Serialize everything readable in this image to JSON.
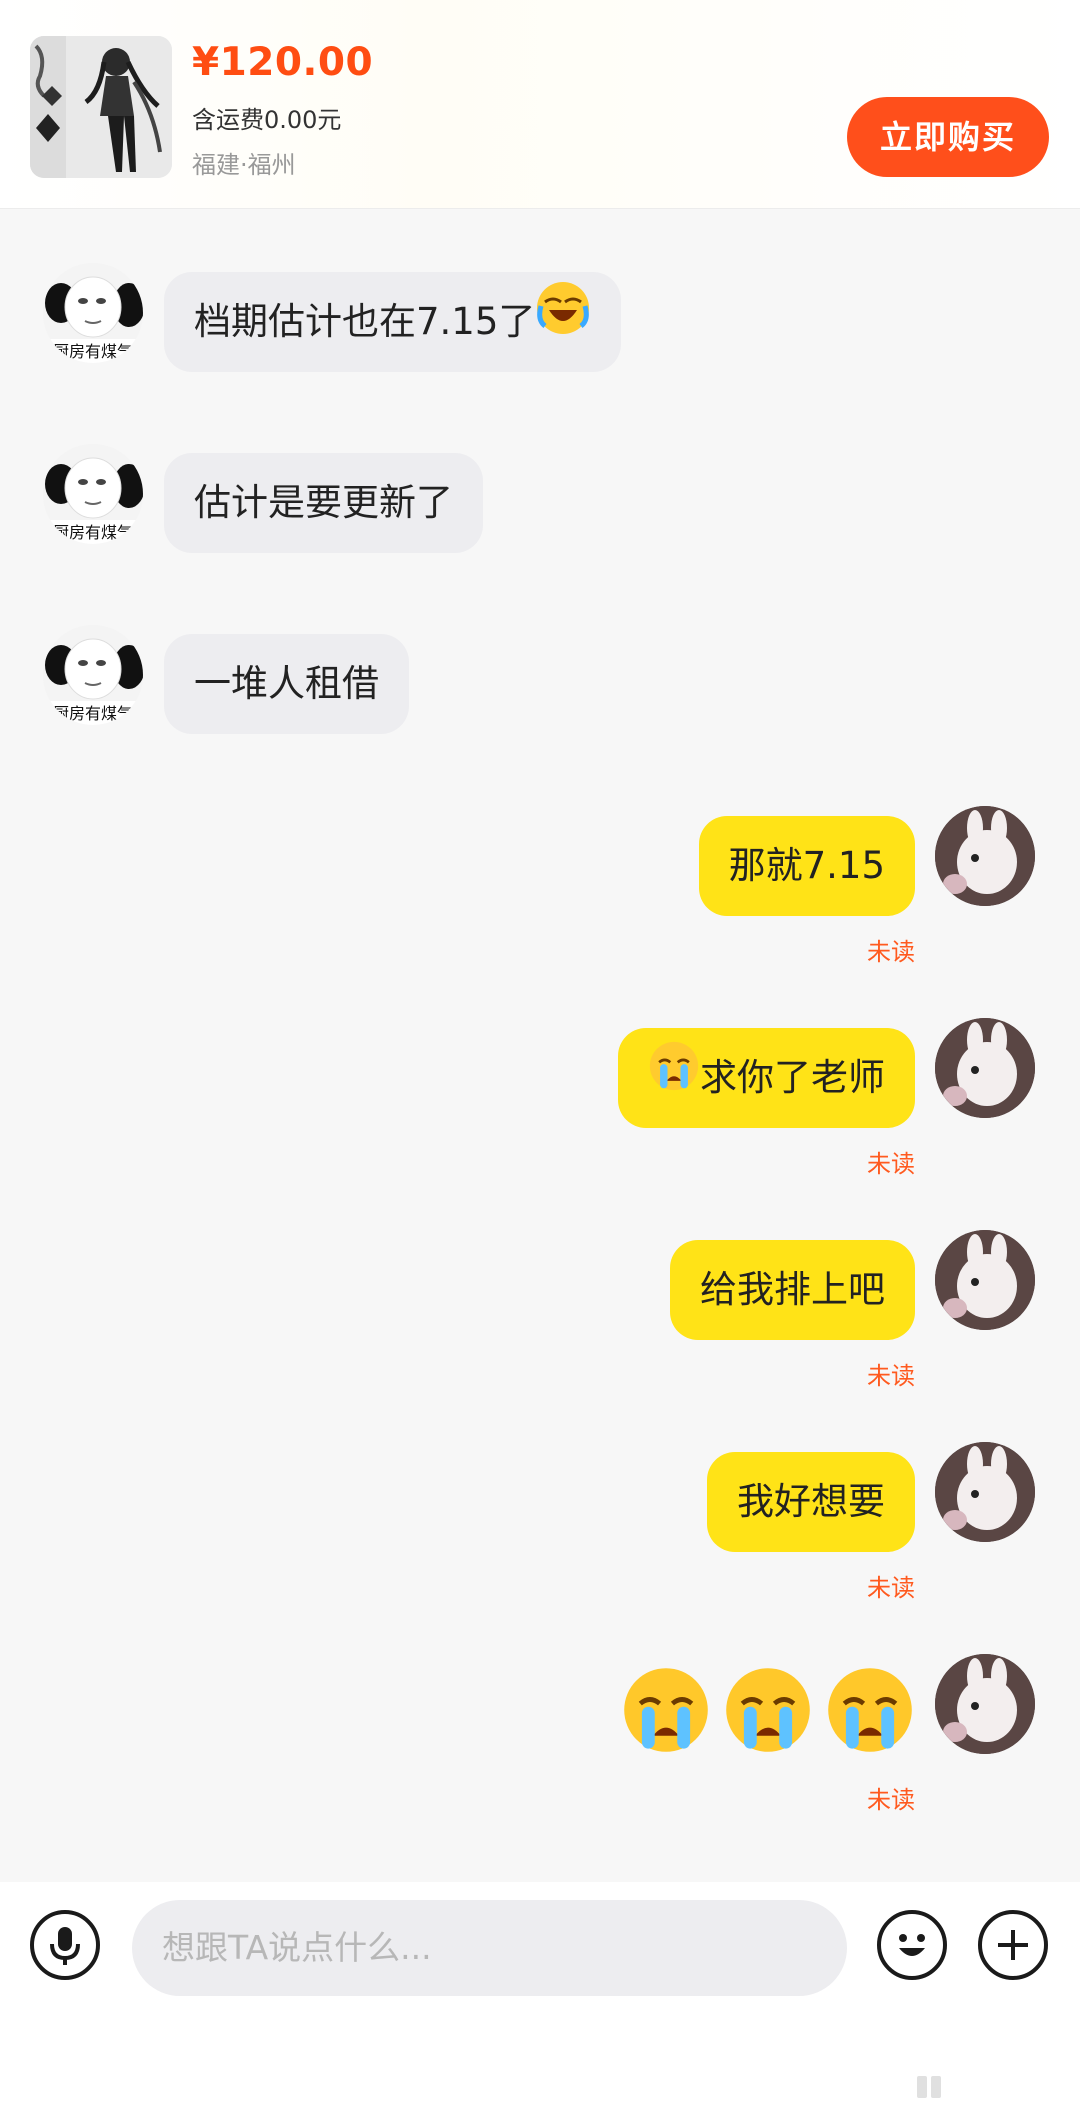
{
  "product": {
    "price": "¥120.00",
    "shipping": "含运费0.00元",
    "location": "福建·福州",
    "buy_button": "立即购买",
    "thumbnail_icon": "product-figure-image"
  },
  "messages": [
    {
      "side": "incoming",
      "text": "档期估计也在7.15了",
      "emoji": "laughing-crying-emoji"
    },
    {
      "side": "incoming",
      "text": "估计是要更新了"
    },
    {
      "side": "incoming",
      "text": "一堆人租借"
    },
    {
      "side": "outgoing",
      "text": "那就7.15",
      "status": "未读"
    },
    {
      "side": "outgoing",
      "text": "求你了老师",
      "emoji": "crying-emoji",
      "status": "未读"
    },
    {
      "side": "outgoing",
      "text": "给我排上吧",
      "status": "未读"
    },
    {
      "side": "outgoing",
      "text": "我好想要",
      "status": "未读"
    },
    {
      "side": "outgoing",
      "emoji_only": [
        "crying-emoji",
        "crying-emoji",
        "crying-emoji"
      ],
      "status": "未读"
    }
  ],
  "input": {
    "placeholder": "想跟TA说点什么...",
    "voice_icon": "microphone-icon",
    "emoji_icon": "smiley-icon",
    "plus_icon": "plus-icon"
  },
  "colors": {
    "accent": "#ff4f1b",
    "outgoing_bubble": "#ffe317",
    "incoming_bubble": "#ededf0",
    "unread_text": "#ff5a1f"
  }
}
